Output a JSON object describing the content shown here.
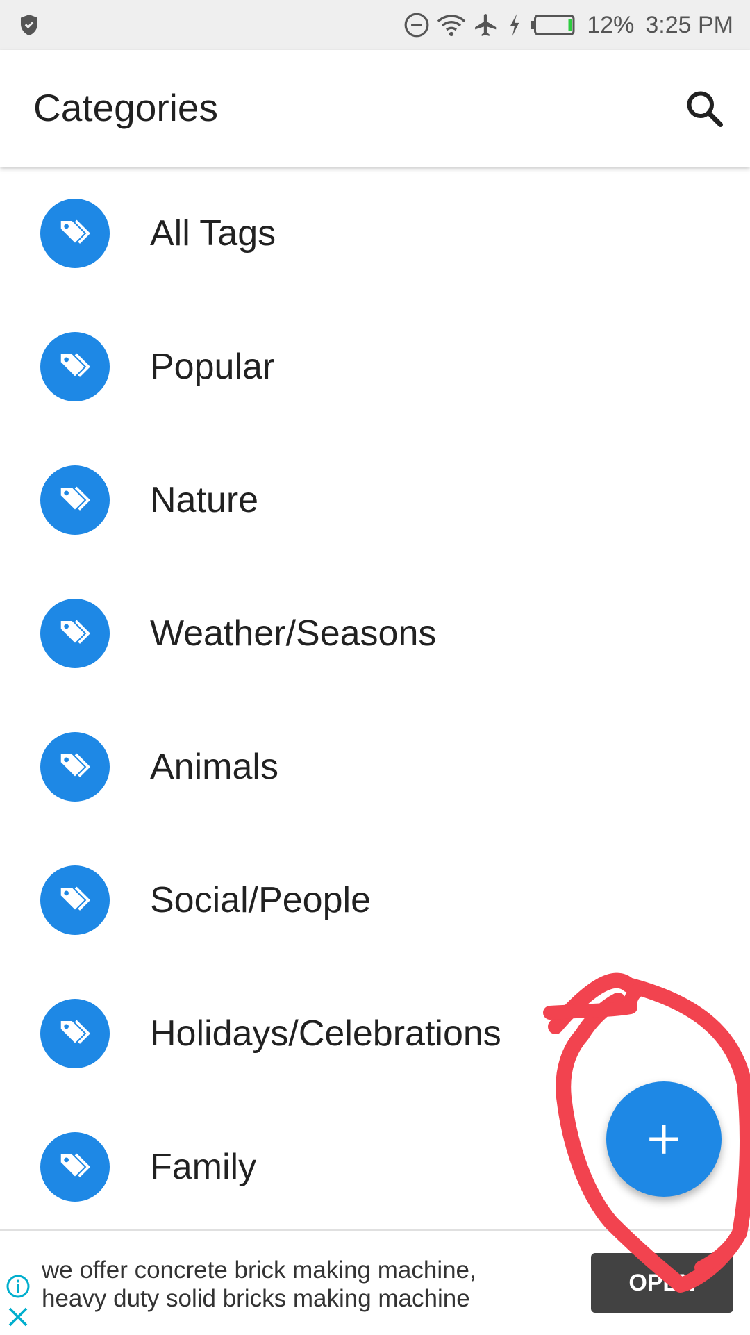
{
  "status_bar": {
    "battery": "12%",
    "time": "3:25 PM",
    "icons": [
      "shield-icon",
      "do-not-disturb-icon",
      "wifi-icon",
      "airplane-icon",
      "charging-icon",
      "battery-icon"
    ]
  },
  "app_bar": {
    "title": "Categories",
    "search_icon": "search-icon"
  },
  "categories": [
    {
      "label": "All Tags",
      "icon": "tag-icon"
    },
    {
      "label": "Popular",
      "icon": "tag-icon"
    },
    {
      "label": "Nature",
      "icon": "tag-icon"
    },
    {
      "label": "Weather/Seasons",
      "icon": "tag-icon"
    },
    {
      "label": "Animals",
      "icon": "tag-icon"
    },
    {
      "label": "Social/People",
      "icon": "tag-icon"
    },
    {
      "label": "Holidays/Celebrations",
      "icon": "tag-icon"
    },
    {
      "label": "Family",
      "icon": "tag-icon"
    }
  ],
  "fab": {
    "icon": "plus-icon"
  },
  "ad": {
    "line1": "we offer concrete brick making machine,",
    "line2": "heavy duty solid bricks making machine",
    "button_label": "OPEN"
  },
  "colors": {
    "accent": "#1e88e5",
    "annotation": "#f2434f",
    "status_bar_bg": "#efefef",
    "ad_button_bg": "#424242"
  }
}
